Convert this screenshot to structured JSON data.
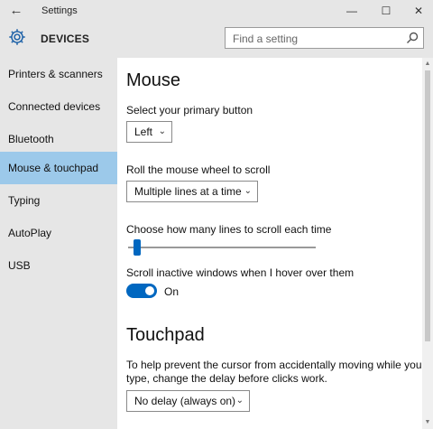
{
  "window": {
    "title": "Settings",
    "back_glyph": "←",
    "min_glyph": "—",
    "max_glyph": "☐",
    "close_glyph": "✕"
  },
  "header": {
    "title": "DEVICES",
    "search_placeholder": "Find a setting"
  },
  "sidebar": {
    "items": [
      {
        "label": "Printers & scanners"
      },
      {
        "label": "Connected devices"
      },
      {
        "label": "Bluetooth"
      },
      {
        "label": "Mouse & touchpad",
        "active": true
      },
      {
        "label": "Typing"
      },
      {
        "label": "AutoPlay"
      },
      {
        "label": "USB"
      }
    ]
  },
  "mouse": {
    "heading": "Mouse",
    "primary_label": "Select your primary button",
    "primary_value": "Left",
    "wheel_label": "Roll the mouse wheel to scroll",
    "wheel_value": "Multiple lines at a time",
    "lines_label": "Choose how many lines to scroll each time",
    "lines_level": 0.03,
    "inactive_label": "Scroll inactive windows when I hover over them",
    "inactive_state": "On"
  },
  "touchpad": {
    "heading": "Touchpad",
    "desc_line1": "To help prevent the cursor from accidentally moving while you",
    "desc_line2": "type, change the delay before clicks work.",
    "delay_value": "No delay (always on)"
  },
  "icons": {
    "settings": "gear-icon",
    "search": "search-icon",
    "chevron": "chevron-down-icon"
  },
  "colors": {
    "accent": "#0067c0",
    "selected": "#9cc9ea",
    "chrome": "#e6e6e6"
  }
}
